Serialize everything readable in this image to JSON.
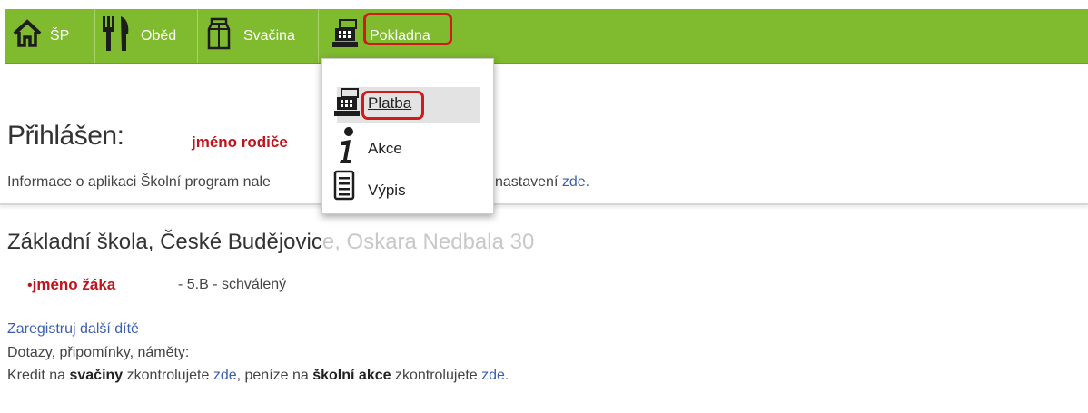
{
  "nav": {
    "items": [
      {
        "label": "ŠP",
        "icon": "home-icon"
      },
      {
        "label": "Oběd",
        "icon": "fork-knife-icon"
      },
      {
        "label": "Svačina",
        "icon": "milk-carton-icon"
      },
      {
        "label": "Pokladna",
        "icon": "cash-register-icon"
      }
    ],
    "bg_color": "#7fba2f",
    "highlight_color": "#d11a1a"
  },
  "dropdown": {
    "items": [
      {
        "label": "Platba",
        "icon": "cash-register-icon"
      },
      {
        "label": "Akce",
        "icon": "info-icon"
      },
      {
        "label": "Výpis",
        "icon": "document-icon"
      }
    ]
  },
  "login": {
    "title": "Přihlášen:",
    "name": "jméno rodiče"
  },
  "info": {
    "prefix": "Informace o aplikaci Školní program nale",
    "suffix": "nastavení",
    "link": "zde."
  },
  "school": {
    "name": "Základní škola, České Budějovic",
    "hidden_tail": "e, Oskara Nedbala 30"
  },
  "student": {
    "bullet": "•",
    "name": "jméno žáka",
    "class_status": "- 5.B - schválený"
  },
  "register_link": "Zaregistruj další dítě",
  "questions": "Dotazy, připomínky, náměty:",
  "credit": {
    "part1": "Kredit na ",
    "bold1": "svačiny",
    "part2": " zkontrolujete ",
    "link1": "zde",
    "part3": ", peníze na ",
    "bold2": "školní akce",
    "part4": " zkontrolujete ",
    "link2": "zde."
  }
}
